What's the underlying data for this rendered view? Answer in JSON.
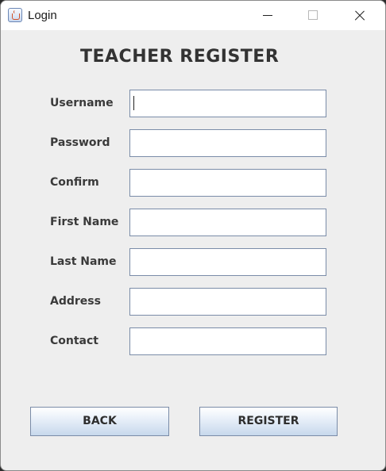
{
  "window": {
    "title": "Login",
    "app_icon": "java-coffee-cup-icon",
    "controls": [
      "minimize-icon",
      "maximize-icon",
      "close-icon"
    ]
  },
  "form": {
    "heading": "TEACHER REGISTER",
    "fields": [
      {
        "label": "Username",
        "value": ""
      },
      {
        "label": "Password",
        "value": ""
      },
      {
        "label": "Confirm",
        "value": ""
      },
      {
        "label": "First Name",
        "value": ""
      },
      {
        "label": "Last Name",
        "value": ""
      },
      {
        "label": "Address",
        "value": ""
      },
      {
        "label": "Contact",
        "value": ""
      }
    ]
  },
  "buttons": {
    "back": "BACK",
    "register": "REGISTER"
  }
}
